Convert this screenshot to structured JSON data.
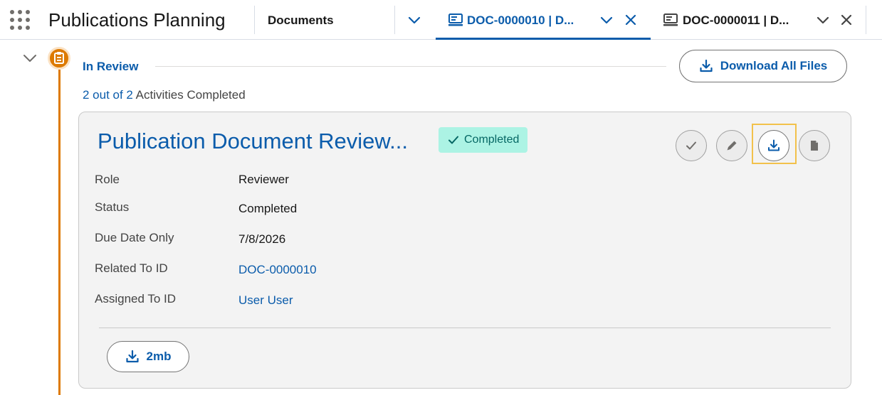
{
  "app": {
    "name": "Publications Planning"
  },
  "nav": {
    "item_label": "Documents"
  },
  "tabs": [
    {
      "label": "DOC-0000010 | D...",
      "active": true
    },
    {
      "label": "DOC-0000011 | D...",
      "active": false
    }
  ],
  "stage": {
    "title": "In Review",
    "download_all_label": "Download All Files",
    "progress_count": "2 out of 2",
    "progress_suffix": " Activities Completed"
  },
  "activity": {
    "title": "Publication Document Review...",
    "badge": "Completed",
    "fields": [
      {
        "label": "Role",
        "value": "Reviewer",
        "link": false
      },
      {
        "label": "Status",
        "value": "Completed",
        "link": false
      },
      {
        "label": "Due Date Only",
        "value": "7/8/2026",
        "link": false
      },
      {
        "label": "Related To ID",
        "value": "DOC-0000010",
        "link": true
      },
      {
        "label": "Assigned To ID",
        "value": "User User",
        "link": true
      }
    ],
    "file_size": "2mb"
  },
  "icons": {
    "app_launcher": "waffle-icon",
    "nav_chevron": "chevron-down-icon",
    "tab_record": "record-icon",
    "tab_close": "close-icon",
    "stage": "document-stage-icon",
    "download": "download-icon",
    "check": "check-icon",
    "edit": "pencil-icon",
    "file": "file-icon"
  },
  "colors": {
    "brand_blue": "#0b5cab",
    "timeline_orange": "#dd7a01",
    "badge_bg": "#acf3e4",
    "badge_text": "#056764",
    "focus_highlight": "#f2c14b"
  }
}
